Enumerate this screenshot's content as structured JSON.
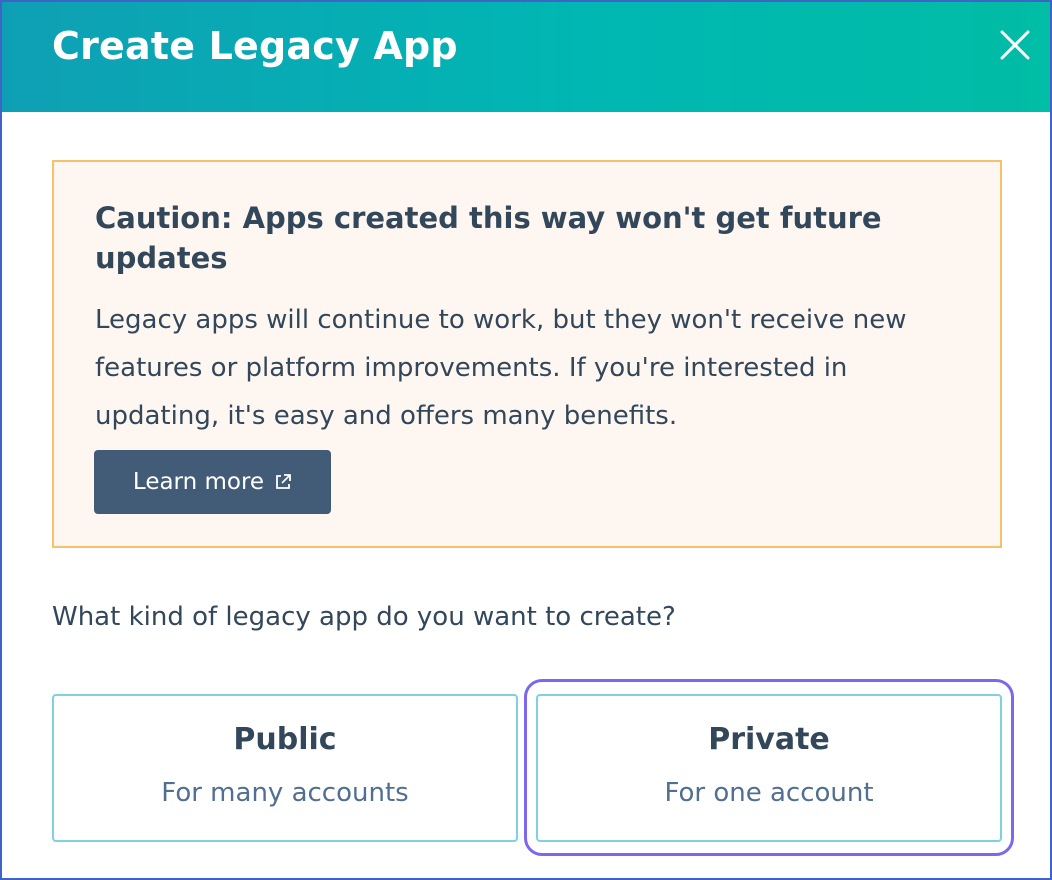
{
  "dialog": {
    "title": "Create Legacy App",
    "close_icon": "close-icon"
  },
  "caution": {
    "title": "Caution: Apps created this way won't get future updates",
    "body": "Legacy apps will continue to work, but they won't receive new features or platform improvements. If you're interested in updating, it's easy and offers many benefits.",
    "learn_more_label": "Learn more",
    "learn_more_icon": "external-link-icon"
  },
  "question": "What kind of legacy app do you want to create?",
  "options": [
    {
      "title": "Public",
      "subtitle": "For many accounts"
    },
    {
      "title": "Private",
      "subtitle": "For one account"
    }
  ],
  "colors": {
    "header_gradient_start": "#0f9fb4",
    "header_gradient_end": "#00bda5",
    "caution_background": "#fef6f0",
    "caution_border": "#f5c26b",
    "button_background": "#425b76",
    "option_border": "#7fd1de",
    "focus_ring": "#7b68ee",
    "text_primary": "#33475b"
  }
}
